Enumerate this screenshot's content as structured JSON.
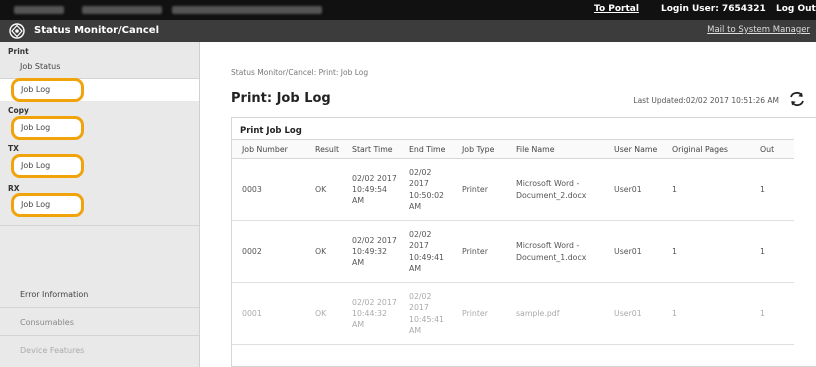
{
  "topbar": {
    "portal_link": "To Portal",
    "login_user": "Login User:  7654321",
    "logout": "Log Out"
  },
  "header": {
    "title": "Status Monitor/Cancel",
    "mail_link": "Mail to System Manager"
  },
  "sidebar": {
    "print_header": "Print",
    "job_status": "Job Status",
    "print_job_log": "Job Log",
    "copy_header": "Copy",
    "copy_job_log": "Job Log",
    "tx_header": "TX",
    "tx_job_log": "Job Log",
    "rx_header": "RX",
    "rx_job_log": "Job Log",
    "error_information": "Error Information",
    "consumables": "Consumables",
    "device_features": "Device Features",
    "highlight_color": "#f0a30a"
  },
  "main": {
    "breadcrumb": "Status Monitor/Cancel: Print: Job Log",
    "page_title": "Print: Job Log",
    "last_updated": "Last Updated:02/02 2017 10:51:26 AM",
    "panel_title": "Print Job Log",
    "columns": [
      "Job Number",
      "Result",
      "Start Time",
      "End Time",
      "Job Type",
      "File Name",
      "User Name",
      "Original Pages",
      "Out"
    ],
    "rows": [
      {
        "job_number": "0003",
        "result": "OK",
        "start_time": "02/02 2017 10:49:54 AM",
        "end_time": "02/02 2017 10:50:02 AM",
        "job_type": "Printer",
        "file_name": "Microsoft Word - Document_2.docx",
        "user_name": "User01",
        "original_pages": "1",
        "output": "1"
      },
      {
        "job_number": "0002",
        "result": "OK",
        "start_time": "02/02 2017 10:49:32 AM",
        "end_time": "02/02 2017 10:49:41 AM",
        "job_type": "Printer",
        "file_name": "Microsoft Word - Document_1.docx",
        "user_name": "User01",
        "original_pages": "1",
        "output": "1"
      },
      {
        "job_number": "0001",
        "result": "OK",
        "start_time": "02/02 2017 10:44:32 AM",
        "end_time": "02/02 2017 10:45:41 AM",
        "job_type": "Printer",
        "file_name": "sample.pdf",
        "user_name": "User01",
        "original_pages": "1",
        "output": "1"
      }
    ]
  }
}
